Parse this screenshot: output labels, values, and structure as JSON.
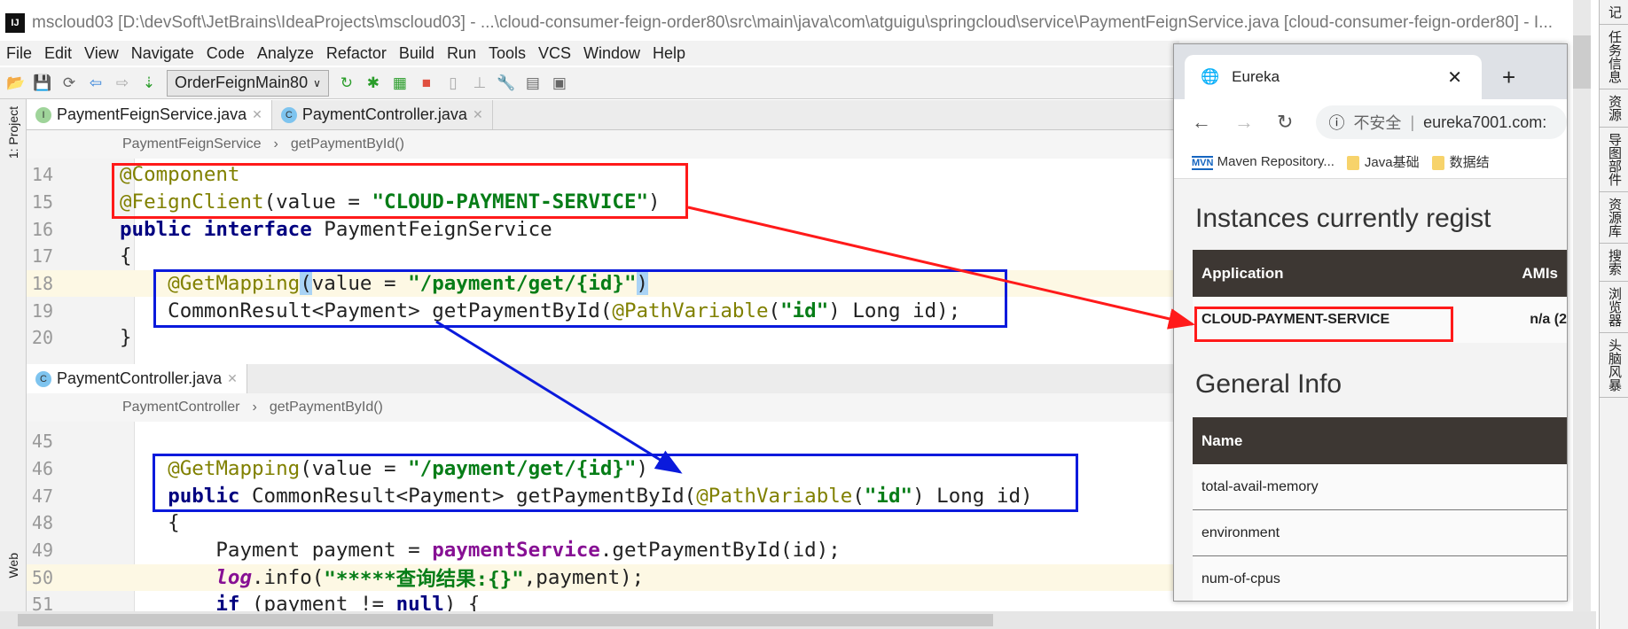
{
  "window": {
    "title": "mscloud03 [D:\\devSoft\\JetBrains\\IdeaProjects\\mscloud03] - ...\\cloud-consumer-feign-order80\\src\\main\\java\\com\\atguigu\\springcloud\\service\\PaymentFeignService.java [cloud-consumer-feign-order80] - I...",
    "logo": "IJ"
  },
  "menu": [
    "File",
    "Edit",
    "View",
    "Navigate",
    "Code",
    "Analyze",
    "Refactor",
    "Build",
    "Run",
    "Tools",
    "VCS",
    "Window",
    "Help"
  ],
  "toolbar": {
    "run_config": "OrderFeignMain80",
    "icons": [
      "open-folder-icon",
      "save-icon",
      "sync-icon",
      "back-icon",
      "forward-icon",
      "build-icon",
      "run-icon",
      "debug-icon",
      "coverage-icon",
      "stop-icon",
      "sdk-icon",
      "structure-icon",
      "settings-icon",
      "project-structure-icon",
      "database-icon"
    ]
  },
  "left_strip": {
    "project": "1: Project",
    "web": "Web"
  },
  "editor_top": {
    "tabs": [
      {
        "label": "PaymentFeignService.java",
        "badge": "I"
      },
      {
        "label": "PaymentController.java",
        "badge": "C"
      }
    ],
    "breadcrumb": [
      "PaymentFeignService",
      "getPaymentById()"
    ],
    "lines": [
      {
        "n": "14",
        "cur": false,
        "tokens": [
          [
            "@Component",
            "ann"
          ]
        ]
      },
      {
        "n": "15",
        "cur": false,
        "tokens": [
          [
            "@FeignClient",
            "ann"
          ],
          [
            "(value = ",
            ""
          ],
          [
            "\"CLOUD-PAYMENT-SERVICE\"",
            "str"
          ],
          [
            ")",
            ""
          ]
        ]
      },
      {
        "n": "16",
        "cur": false,
        "tokens": [
          [
            "public interface ",
            "kw"
          ],
          [
            "PaymentFeignService",
            ""
          ]
        ]
      },
      {
        "n": "17",
        "cur": false,
        "tokens": [
          [
            "{",
            ""
          ]
        ]
      },
      {
        "n": "18",
        "cur": true,
        "tokens": [
          [
            "    ",
            ""
          ],
          [
            "@GetMapping",
            "ann"
          ],
          [
            "(",
            "par"
          ],
          [
            "value = ",
            ""
          ],
          [
            "\"/payment/get/{id}\"",
            "str"
          ],
          [
            ")",
            "par"
          ]
        ]
      },
      {
        "n": "19",
        "cur": false,
        "tokens": [
          [
            "    CommonResult<Payment> getPaymentById(",
            ""
          ],
          [
            "@PathVariable",
            "ann"
          ],
          [
            "(",
            ""
          ],
          [
            "\"id\"",
            "str"
          ],
          [
            ") Long id);",
            ""
          ]
        ]
      },
      {
        "n": "20",
        "cur": false,
        "tokens": [
          [
            "}",
            ""
          ]
        ]
      }
    ]
  },
  "editor_bottom": {
    "tab": {
      "label": "PaymentController.java",
      "badge": "C"
    },
    "breadcrumb": [
      "PaymentController",
      "getPaymentById()"
    ],
    "lines": [
      {
        "n": "45",
        "cur": false,
        "tokens": []
      },
      {
        "n": "46",
        "cur": false,
        "tokens": [
          [
            "    ",
            ""
          ],
          [
            "@GetMapping",
            "ann"
          ],
          [
            "(value = ",
            ""
          ],
          [
            "\"/payment/get/{id}\"",
            "str"
          ],
          [
            ")",
            ""
          ]
        ]
      },
      {
        "n": "47",
        "cur": false,
        "tokens": [
          [
            "    ",
            ""
          ],
          [
            "public ",
            "kw"
          ],
          [
            "CommonResult<Payment> getPaymentById(",
            ""
          ],
          [
            "@PathVariable",
            "ann"
          ],
          [
            "(",
            ""
          ],
          [
            "\"id\"",
            "str"
          ],
          [
            ") Long id)",
            ""
          ]
        ]
      },
      {
        "n": "48",
        "cur": false,
        "tokens": [
          [
            "    {",
            ""
          ]
        ]
      },
      {
        "n": "49",
        "cur": false,
        "tokens": [
          [
            "        Payment payment = ",
            ""
          ],
          [
            "paymentService",
            "fld"
          ],
          [
            ".getPaymentById(id);",
            ""
          ]
        ]
      },
      {
        "n": "50",
        "cur": true,
        "tokens": [
          [
            "        ",
            ""
          ],
          [
            "log",
            "it"
          ],
          [
            ".info(",
            ""
          ],
          [
            "\"*****查询结果:{}\"",
            "str"
          ],
          [
            ",payment);",
            ""
          ]
        ]
      },
      {
        "n": "51",
        "cur": false,
        "tokens": [
          [
            "        ",
            ""
          ],
          [
            "if ",
            "kw"
          ],
          [
            "(payment != ",
            ""
          ],
          [
            "null",
            "kw"
          ],
          [
            ") {",
            ""
          ]
        ]
      }
    ]
  },
  "browser": {
    "tab_title": "Eureka",
    "security": "不安全",
    "url": "eureka7001.com:",
    "bookmarks": [
      "Maven Repository...",
      "Java基础",
      "数据结"
    ],
    "instances_heading": "Instances currently regist",
    "instances_cols": [
      "Application",
      "AMIs"
    ],
    "instances_rows": [
      [
        "CLOUD-PAYMENT-SERVICE",
        "n/a (2"
      ]
    ],
    "general_heading": "General Info",
    "general_col": "Name",
    "general_rows": [
      "total-avail-memory",
      "environment",
      "num-of-cpus"
    ]
  },
  "right_sidebar": [
    "记",
    "任务信息",
    "资源",
    "导图部件",
    "资源库",
    "搜索",
    "浏览器",
    "头脑风暴"
  ],
  "annotation_colors": {
    "red": "#ff1a1a",
    "blue": "#0a1adc"
  }
}
